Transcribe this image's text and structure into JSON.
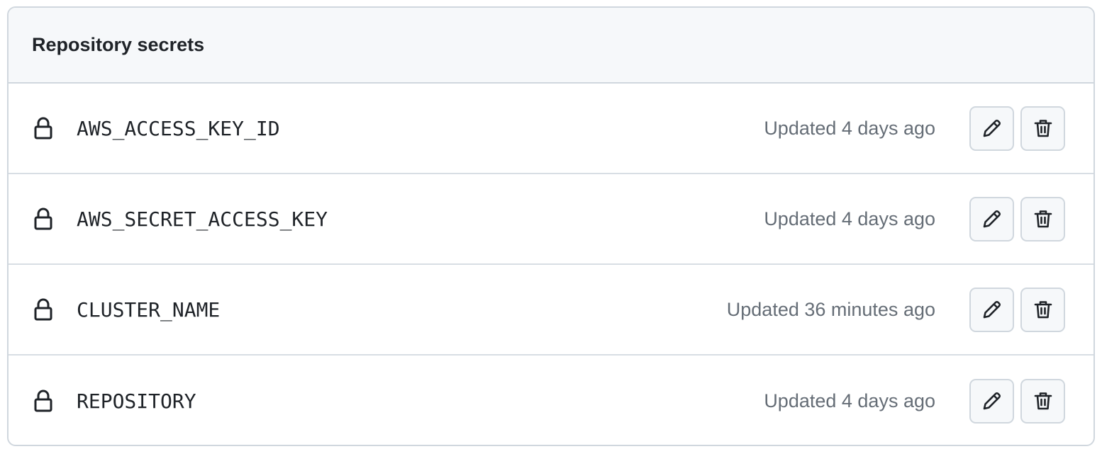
{
  "header": {
    "title": "Repository secrets"
  },
  "secrets": [
    {
      "name": "AWS_ACCESS_KEY_ID",
      "updated": "Updated 4 days ago"
    },
    {
      "name": "AWS_SECRET_ACCESS_KEY",
      "updated": "Updated 4 days ago"
    },
    {
      "name": "CLUSTER_NAME",
      "updated": "Updated 36 minutes ago"
    },
    {
      "name": "REPOSITORY",
      "updated": "Updated 4 days ago"
    }
  ],
  "icons": {
    "row_icon": "lock-icon",
    "edit": "pencil-icon",
    "delete": "trash-icon"
  },
  "colors": {
    "header_bg": "#f6f8fa",
    "border": "#d0d7de",
    "text": "#1f2328",
    "muted_text": "#656d76"
  }
}
